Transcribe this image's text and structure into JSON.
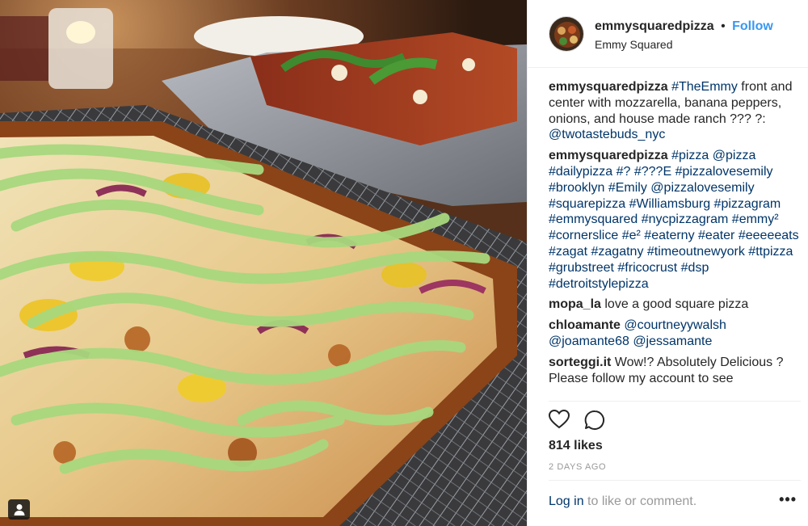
{
  "post": {
    "username": "emmysquaredpizza",
    "separator": "•",
    "follow_label": "Follow",
    "location": "Emmy Squared"
  },
  "comments": [
    {
      "user": "emmysquaredpizza",
      "segments": [
        {
          "text": " ",
          "link": false
        },
        {
          "text": "#TheEmmy",
          "link": true
        },
        {
          "text": " front and center with mozzarella, banana peppers, onions, and house made ranch ",
          "link": false
        },
        {
          "text": "???",
          "link": false
        },
        {
          "text": " ",
          "link": false
        },
        {
          "text": "?",
          "link": false
        },
        {
          "text": ": ",
          "link": false
        },
        {
          "text": "@twotastebuds_nyc",
          "link": true
        }
      ]
    },
    {
      "user": "emmysquaredpizza",
      "segments": [
        {
          "text": " ",
          "link": false
        },
        {
          "text": "#pizza",
          "link": true
        },
        {
          "text": " ",
          "link": false
        },
        {
          "text": "@pizza",
          "link": true
        },
        {
          "text": " ",
          "link": false
        },
        {
          "text": "#dailypizza",
          "link": true
        },
        {
          "text": " ",
          "link": false
        },
        {
          "text": "#?",
          "link": true
        },
        {
          "text": " ",
          "link": false
        },
        {
          "text": "#???E",
          "link": true
        },
        {
          "text": " ",
          "link": false
        },
        {
          "text": "#pizzalovesemily",
          "link": true
        },
        {
          "text": " ",
          "link": false
        },
        {
          "text": "#brooklyn",
          "link": true
        },
        {
          "text": " ",
          "link": false
        },
        {
          "text": "#Emily",
          "link": true
        },
        {
          "text": " ",
          "link": false
        },
        {
          "text": "@pizzalovesemily",
          "link": true
        },
        {
          "text": " ",
          "link": false
        },
        {
          "text": "#squarepizza",
          "link": true
        },
        {
          "text": " ",
          "link": false
        },
        {
          "text": "#Williamsburg",
          "link": true
        },
        {
          "text": " ",
          "link": false
        },
        {
          "text": "#pizzagram",
          "link": true
        },
        {
          "text": " ",
          "link": false
        },
        {
          "text": "#emmysquared",
          "link": true
        },
        {
          "text": " ",
          "link": false
        },
        {
          "text": "#nycpizzagram",
          "link": true
        },
        {
          "text": " ",
          "link": false
        },
        {
          "text": "#emmy²",
          "link": true
        },
        {
          "text": " ",
          "link": false
        },
        {
          "text": "#cornerslice",
          "link": true
        },
        {
          "text": " ",
          "link": false
        },
        {
          "text": "#e²",
          "link": true
        },
        {
          "text": " ",
          "link": false
        },
        {
          "text": "#eaterny",
          "link": true
        },
        {
          "text": " ",
          "link": false
        },
        {
          "text": "#eater",
          "link": true
        },
        {
          "text": " ",
          "link": false
        },
        {
          "text": "#eeeeeats",
          "link": true
        },
        {
          "text": " ",
          "link": false
        },
        {
          "text": "#zagat",
          "link": true
        },
        {
          "text": " ",
          "link": false
        },
        {
          "text": "#zagatny",
          "link": true
        },
        {
          "text": " ",
          "link": false
        },
        {
          "text": "#timeoutnewyork",
          "link": true
        },
        {
          "text": " ",
          "link": false
        },
        {
          "text": "#ttpizza",
          "link": true
        },
        {
          "text": " ",
          "link": false
        },
        {
          "text": "#grubstreet",
          "link": true
        },
        {
          "text": " ",
          "link": false
        },
        {
          "text": "#fricocrust",
          "link": true
        },
        {
          "text": " ",
          "link": false
        },
        {
          "text": "#dsp",
          "link": true
        },
        {
          "text": " ",
          "link": false
        },
        {
          "text": "#detroitstylepizza",
          "link": true
        }
      ]
    },
    {
      "user": "mopa_la",
      "segments": [
        {
          "text": " love a good square pizza",
          "link": false
        }
      ]
    },
    {
      "user": "chloamante",
      "segments": [
        {
          "text": " ",
          "link": false
        },
        {
          "text": "@courtneyywalsh",
          "link": true
        },
        {
          "text": " ",
          "link": false
        },
        {
          "text": "@joamante68",
          "link": true
        },
        {
          "text": " ",
          "link": false
        },
        {
          "text": "@jessamante",
          "link": true
        }
      ]
    },
    {
      "user": "sorteggi.it",
      "segments": [
        {
          "text": " Wow!? Absolutely Delicious ? Please follow my account to see",
          "link": false
        }
      ]
    }
  ],
  "likes": "814 likes",
  "date": "2 DAYS AGO",
  "login": {
    "link": "Log in",
    "rest": " to like or comment."
  },
  "more_label": "•••",
  "icons": {
    "like": "heart-icon",
    "comment": "comment-icon",
    "tag": "user-tag-icon",
    "more": "more-options-icon"
  },
  "colors": {
    "link": "#003569",
    "follow": "#3897f0",
    "muted": "#999999",
    "text": "#262626"
  }
}
